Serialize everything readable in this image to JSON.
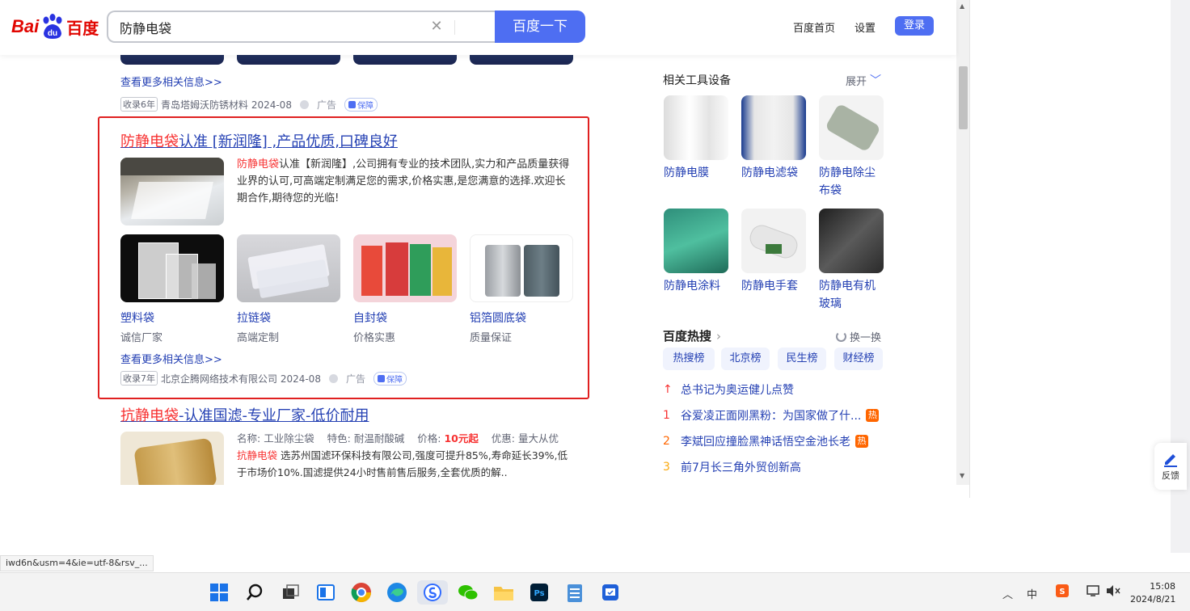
{
  "header": {
    "logo_bai": "Bai",
    "logo_du": "du",
    "logo_text": "百度",
    "search_value": "防静电袋",
    "search_button": "百度一下",
    "nav_home": "百度首页",
    "nav_settings": "设置",
    "login": "登录"
  },
  "result1": {
    "more_link": "查看更多相关信息>>",
    "badge": "收录6年",
    "company": "青岛塔姆沃防锈材料 2024-08",
    "ad": "广告",
    "guarantee": "保障"
  },
  "result2": {
    "title_red": "防静电袋",
    "title_rest": "认准 [新润隆] ,产品优质,口碑良好",
    "desc_red": "防静电袋",
    "desc_rest": "认准【新润隆】,公司拥有专业的技术团队,实力和产品质量获得业界的认可,可高端定制满足您的需求,价格实惠,是您满意的选择.欢迎长期合作,期待您的光临!",
    "products": [
      {
        "name": "塑料袋",
        "sub": "诚信厂家"
      },
      {
        "name": "拉链袋",
        "sub": "高端定制"
      },
      {
        "name": "自封袋",
        "sub": "价格实惠"
      },
      {
        "name": "铝箔圆底袋",
        "sub": "质量保证"
      }
    ],
    "more_link": "查看更多相关信息>>",
    "badge": "收录7年",
    "company": "北京企腾网络技术有限公司 2024-08",
    "ad": "广告",
    "guarantee": "保障"
  },
  "result3": {
    "title_red": "抗静电袋",
    "title_rest": "-认准国滤-专业厂家-低价耐用",
    "spec_name_label": "名称:",
    "spec_name": "工业除尘袋",
    "spec_feature_label": "特色:",
    "spec_feature": "耐温耐酸碱",
    "spec_price_label": "价格:",
    "spec_price": "10元起",
    "spec_offer_label": "优惠:",
    "spec_offer": "量大从优",
    "desc_red": "抗静电袋",
    "desc_rest": " 选苏州国滤环保科技有限公司,强度可提升85%,寿命延长39%,低于市场价10%.国滤提供24小时售前售后服务,全套优质的解.."
  },
  "sidebar": {
    "tools_title": "相关工具设备",
    "expand": "展开",
    "tools": [
      {
        "name": "防静电膜"
      },
      {
        "name": "防静电滤袋"
      },
      {
        "name": "防静电除尘布袋"
      },
      {
        "name": "防静电涂料"
      },
      {
        "name": "防静电手套"
      },
      {
        "name": "防静电有机玻璃"
      }
    ],
    "hot_title": "百度热搜",
    "refresh": "换一换",
    "tabs": [
      "热搜榜",
      "北京榜",
      "民生榜",
      "财经榜"
    ],
    "hot_items": [
      {
        "rank": "↑",
        "text": "总书记为奥运健儿点赞",
        "badge": ""
      },
      {
        "rank": "1",
        "text": "谷爱凌正面刚黑粉：为国家做了什...",
        "badge": "热"
      },
      {
        "rank": "2",
        "text": "李斌回应撞脸黑神话悟空金池长老",
        "badge": "热"
      },
      {
        "rank": "3",
        "text": "前7月长三角外贸创新高",
        "badge": ""
      }
    ]
  },
  "feedback": "反馈",
  "status_url": "iwd6n&usm=4&ie=utf-8&rsv_...",
  "taskbar": {
    "ime": "中",
    "time": "15:08",
    "date": "2024/8/21"
  },
  "colors": {
    "brand_blue": "#4e6ef2",
    "link_blue": "#2440b3",
    "highlight_red": "#f73131",
    "frame_red": "#e02020"
  }
}
